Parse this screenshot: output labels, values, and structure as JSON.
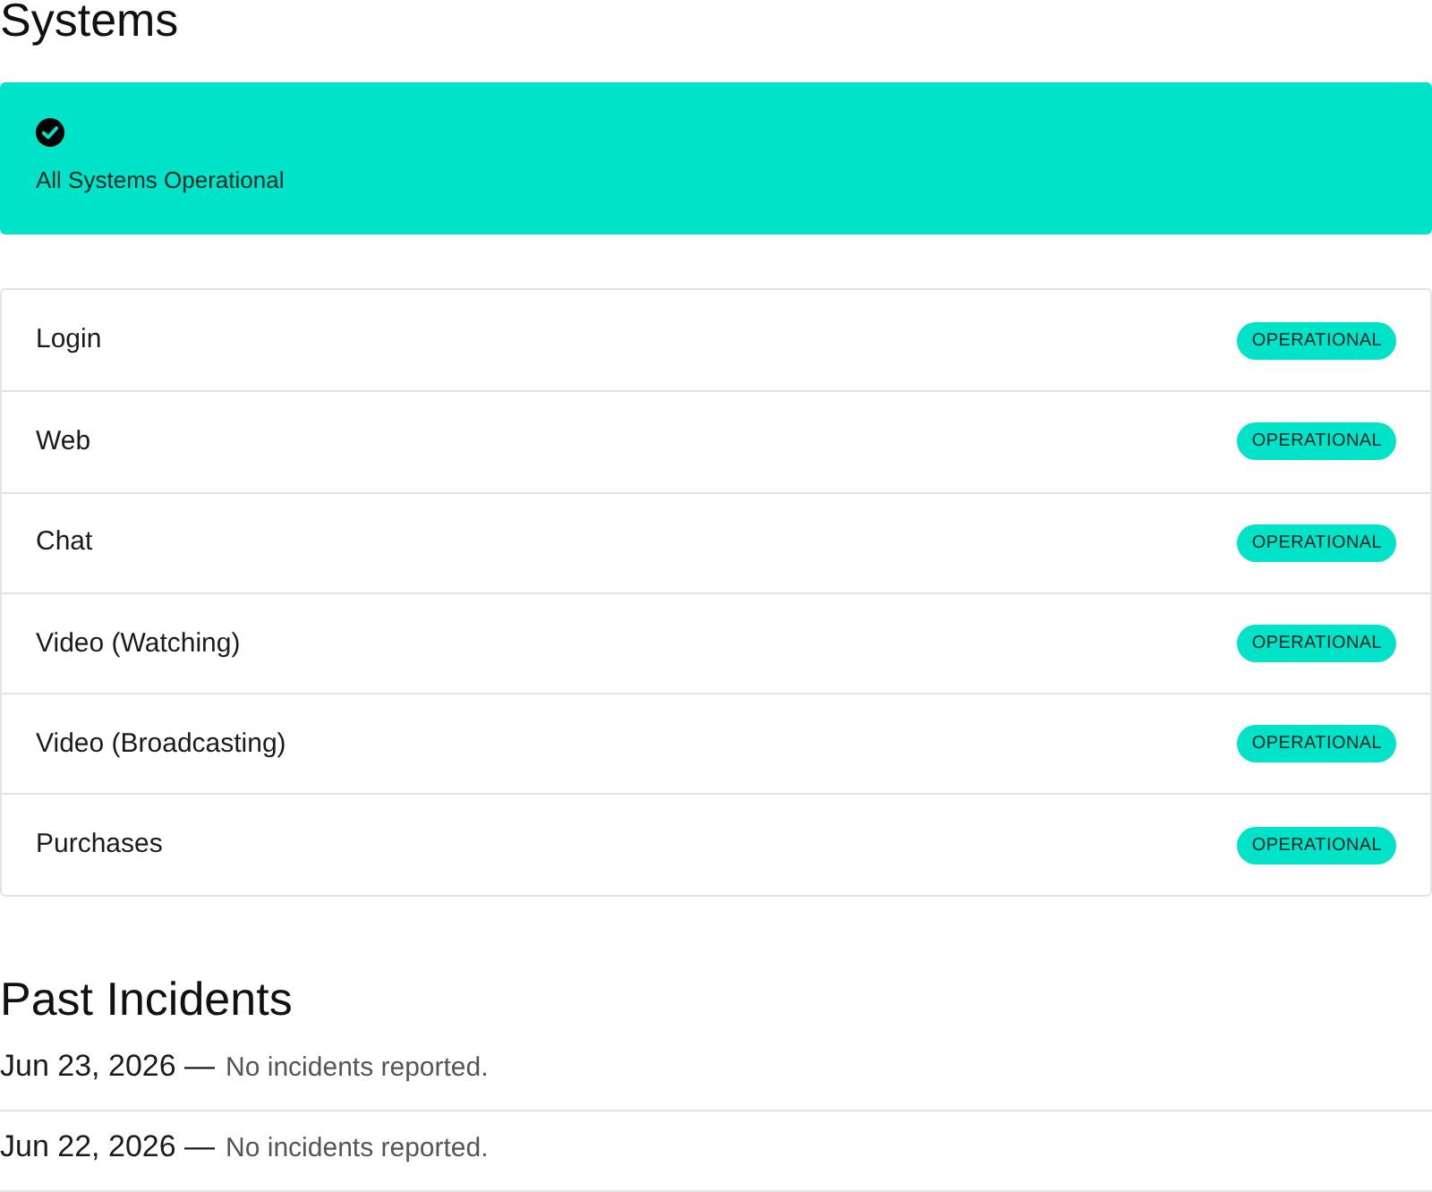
{
  "systems": {
    "title": "Systems",
    "banner": {
      "kind": "operational",
      "text": "All Systems Operational"
    },
    "services": [
      {
        "name": "Login",
        "status": {
          "kind": "operational",
          "label": "OPERATIONAL"
        }
      },
      {
        "name": "Web",
        "status": {
          "kind": "operational",
          "label": "OPERATIONAL"
        }
      },
      {
        "name": "Chat",
        "status": {
          "kind": "operational",
          "label": "OPERATIONAL"
        }
      },
      {
        "name": "Video (Watching)",
        "status": {
          "kind": "operational",
          "label": "OPERATIONAL"
        }
      },
      {
        "name": "Video (Broadcasting)",
        "status": {
          "kind": "operational",
          "label": "OPERATIONAL"
        }
      },
      {
        "name": "Purchases",
        "status": {
          "kind": "operational",
          "label": "OPERATIONAL"
        }
      }
    ]
  },
  "past_incidents": {
    "title": "Past Incidents",
    "days": [
      {
        "date": "Jun 23, 2026 —",
        "note": "No incidents reported."
      },
      {
        "date": "Jun 22, 2026 —",
        "note": "No incidents reported."
      }
    ]
  }
}
